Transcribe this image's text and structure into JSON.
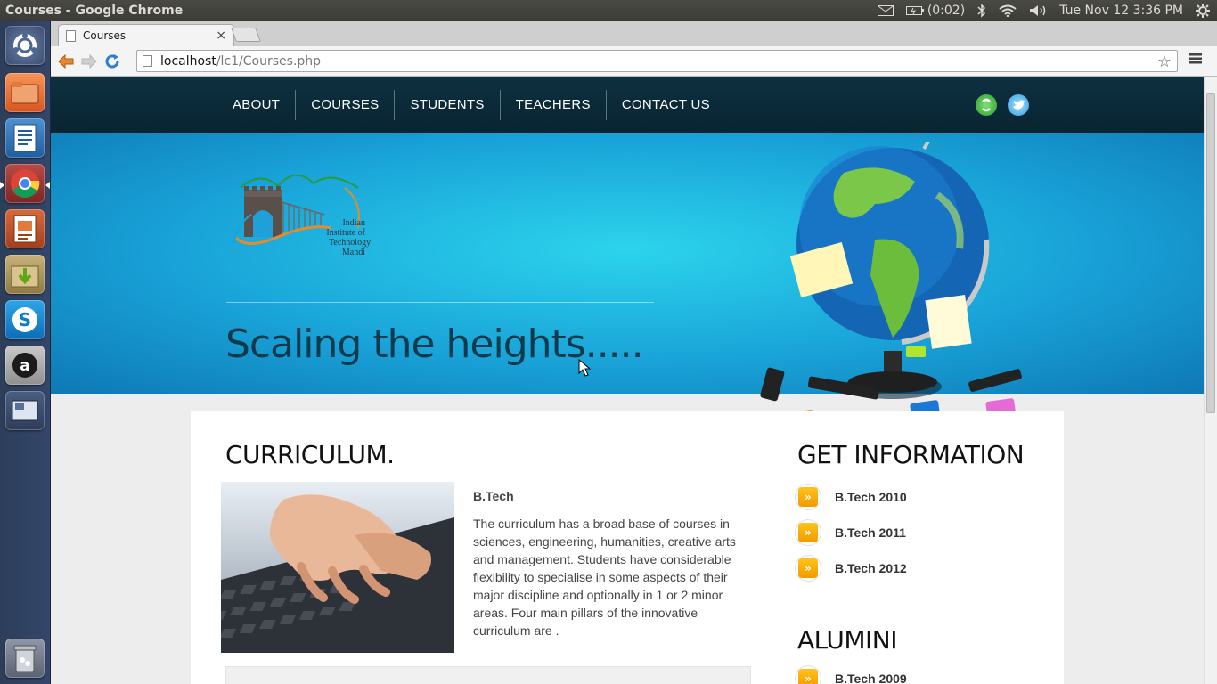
{
  "window": {
    "title": "Courses - Google Chrome"
  },
  "panel": {
    "battery": "(0:02)",
    "datetime": "Tue Nov 12  3:36 PM"
  },
  "launcher": {
    "items": [
      "dash-home",
      "files",
      "libreoffice-writer",
      "chrome",
      "libreoffice-impress",
      "archive-manager",
      "skype",
      "ubuntu-one",
      "workspace-switcher",
      "trash"
    ]
  },
  "browser": {
    "tab_title": "Courses",
    "url_host": "localhost",
    "url_path": "/lc1/Courses.php"
  },
  "site": {
    "nav": [
      "ABOUT",
      "COURSES",
      "STUDENTS",
      "TEACHERS",
      "CONTACT US"
    ],
    "logo_lines": [
      "Indian",
      "Institute of",
      "Technology",
      "Mandi"
    ],
    "tagline": "Scaling the heights.....",
    "curriculum": {
      "heading": "CURRICULUM.",
      "course": "B.Tech",
      "description": "The curriculum has a broad base of courses in sciences, engineering, humanities, creative arts and management. Students have considerable flexibility to specialise in some aspects of their major discipline and optionally in 1 or 2 minor areas. Four main pillars of the innovative curriculum are ."
    },
    "get_information": {
      "heading": "GET INFORMATION",
      "links": [
        "B.Tech 2010",
        "B.Tech 2011",
        "B.Tech 2012"
      ]
    },
    "alumini": {
      "heading": "ALUMINI",
      "links": [
        "B.Tech 2009"
      ]
    }
  },
  "colors": {
    "nav_bg": "#0c3040",
    "banner": "#19a3d8",
    "accent_orange": "#f39a00"
  }
}
